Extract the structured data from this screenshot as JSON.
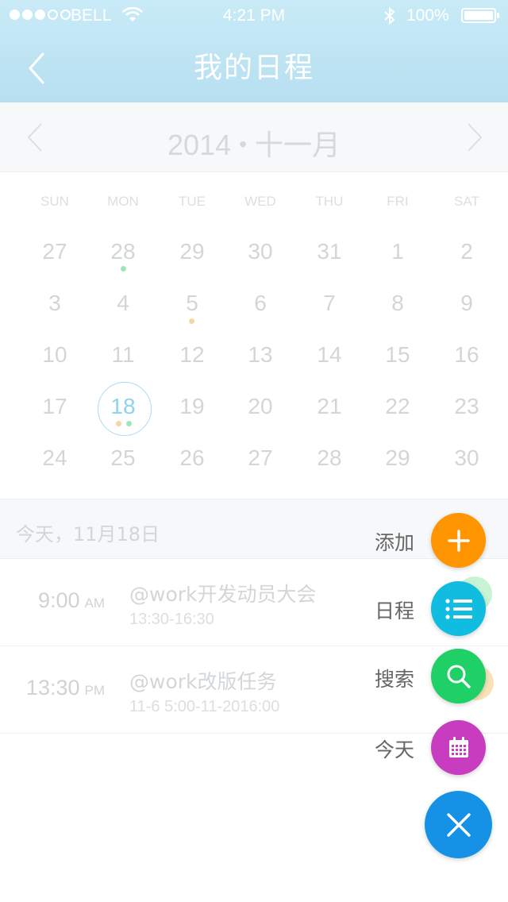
{
  "status_bar": {
    "carrier": "BELL",
    "time": "4:21 PM",
    "battery": "100%"
  },
  "nav": {
    "title": "我的日程"
  },
  "calendar": {
    "year": "2014",
    "separator": "•",
    "month": "十一月",
    "weekdays": [
      "SUN",
      "MON",
      "TUE",
      "WED",
      "THU",
      "FRI",
      "SAT"
    ],
    "weeks": [
      [
        "27",
        "28",
        "29",
        "30",
        "31",
        "1",
        "2"
      ],
      [
        "3",
        "4",
        "5",
        "6",
        "7",
        "8",
        "9"
      ],
      [
        "10",
        "11",
        "12",
        "13",
        "14",
        "15",
        "16"
      ],
      [
        "17",
        "18",
        "19",
        "20",
        "21",
        "22",
        "23"
      ],
      [
        "24",
        "25",
        "26",
        "27",
        "28",
        "29",
        "30"
      ]
    ],
    "selected_day": "18"
  },
  "colors": {
    "green_mark": "#9ee8b8",
    "orange_mark": "#f6d7a2",
    "add": "#ff9500",
    "schedule": "#10bde0",
    "search": "#1fd067",
    "today": "#c83cbf",
    "close": "#1592e6"
  },
  "agenda": {
    "date_header": "今天，11月18日",
    "events": [
      {
        "time": "9:00",
        "period": "AM",
        "title": "@work开发动员大会",
        "detail": "13:30-16:30"
      },
      {
        "time": "13:30",
        "period": "PM",
        "title": "@work改版任务",
        "detail": "11-6 5:00-11-2016:00"
      }
    ]
  },
  "fab_menu": {
    "items": [
      {
        "label": "添加",
        "icon": "plus-icon"
      },
      {
        "label": "日程",
        "icon": "list-icon"
      },
      {
        "label": "搜索",
        "icon": "search-icon"
      },
      {
        "label": "今天",
        "icon": "calendar-icon"
      }
    ],
    "close_icon": "close-icon"
  }
}
